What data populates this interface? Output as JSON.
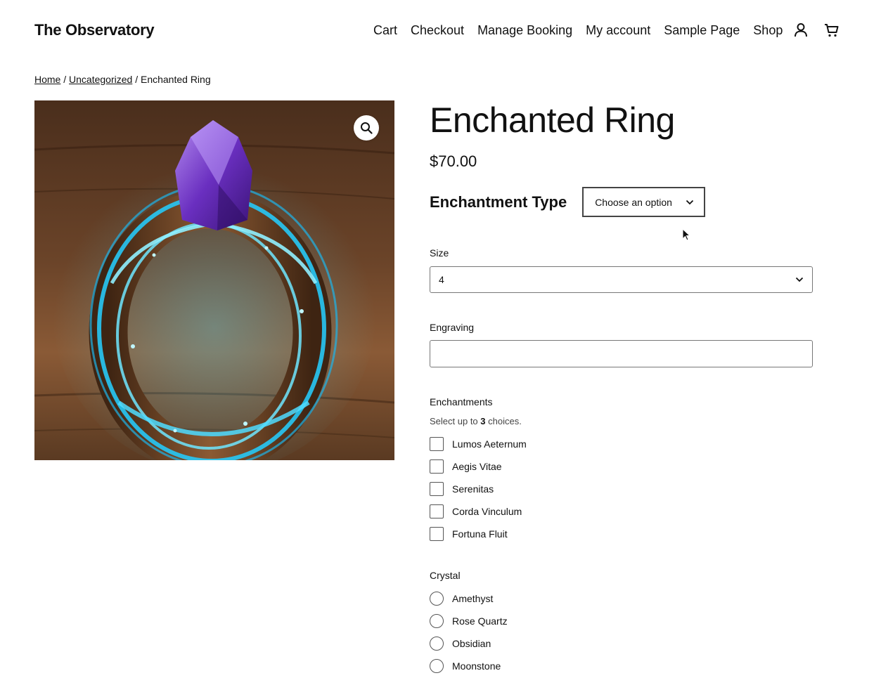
{
  "site": {
    "title": "The Observatory"
  },
  "nav": {
    "items": [
      "Cart",
      "Checkout",
      "Manage Booking",
      "My account",
      "Sample Page",
      "Shop"
    ],
    "icons": [
      "user-icon",
      "cart-icon"
    ]
  },
  "breadcrumb": {
    "home": "Home",
    "category": "Uncategorized",
    "separator": "/",
    "current": "Enchanted Ring"
  },
  "product": {
    "title": "Enchanted Ring",
    "price": "$70.00",
    "image_icon": "zoom-icon"
  },
  "form": {
    "enchantment_type": {
      "label": "Enchantment Type",
      "value": "Choose an option"
    },
    "size": {
      "label": "Size",
      "value": "4"
    },
    "engraving": {
      "label": "Engraving",
      "value": ""
    },
    "enchantments": {
      "label": "Enchantments",
      "hint_prefix": "Select up to",
      "hint_count": "3",
      "hint_suffix": "choices.",
      "options": [
        "Lumos Aeternum",
        "Aegis Vitae",
        "Serenitas",
        "Corda Vinculum",
        "Fortuna Fluit"
      ]
    },
    "crystal": {
      "label": "Crystal",
      "options": [
        "Amethyst",
        "Rose Quartz",
        "Obsidian",
        "Moonstone"
      ]
    }
  }
}
